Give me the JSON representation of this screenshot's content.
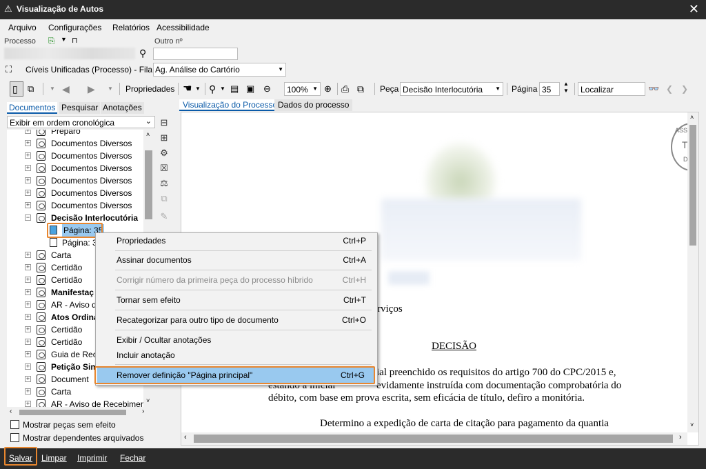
{
  "window": {
    "title": "Visualização de Autos",
    "close_glyph": "✕"
  },
  "menu": [
    "Arquivo",
    "Configurações",
    "Relatórios",
    "Acessibilidade"
  ],
  "process": {
    "label": "Processo",
    "other_label": "Outro nº",
    "other_value": ""
  },
  "queue": {
    "class_text": "Cíveis Unificadas (Processo) - Fila:",
    "fila_value": "Ag. Análise do Cartório"
  },
  "toolbar": {
    "properties_label": "Propriedades",
    "zoom_value": "100%",
    "peca_label": "Peça",
    "peca_value": "Decisão Interlocutória",
    "pagina_label": "Página",
    "pagina_value": "35",
    "localizar_placeholder": "Localizar"
  },
  "left_tabs": [
    "Documentos",
    "Pesquisar",
    "Anotações"
  ],
  "order_select": "Exibir em ordem cronológica",
  "tree": [
    {
      "label": "Preparo",
      "bold": false,
      "type": "doc"
    },
    {
      "label": "Documentos Diversos",
      "bold": false,
      "type": "doc"
    },
    {
      "label": "Documentos Diversos",
      "bold": false,
      "type": "doc"
    },
    {
      "label": "Documentos Diversos",
      "bold": false,
      "type": "doc"
    },
    {
      "label": "Documentos Diversos",
      "bold": false,
      "type": "doc"
    },
    {
      "label": "Documentos Diversos",
      "bold": false,
      "type": "doc"
    },
    {
      "label": "Documentos Diversos",
      "bold": false,
      "type": "doc"
    },
    {
      "label": "Decisão Interlocutória",
      "bold": true,
      "type": "doc-open"
    },
    {
      "label": "Página: 35",
      "bold": false,
      "type": "page-selected"
    },
    {
      "label": "Página: 3",
      "bold": false,
      "type": "page"
    },
    {
      "label": "Carta",
      "bold": false,
      "type": "doc"
    },
    {
      "label": "Certidão",
      "bold": false,
      "type": "doc"
    },
    {
      "label": "Certidão",
      "bold": false,
      "type": "doc"
    },
    {
      "label": "Manifestaç",
      "bold": true,
      "type": "doc"
    },
    {
      "label": "AR - Aviso de",
      "bold": false,
      "type": "doc"
    },
    {
      "label": "Atos Ordina",
      "bold": true,
      "type": "doc"
    },
    {
      "label": "Certidão",
      "bold": false,
      "type": "doc"
    },
    {
      "label": "Certidão",
      "bold": false,
      "type": "doc"
    },
    {
      "label": "Guia de Reco",
      "bold": false,
      "type": "doc"
    },
    {
      "label": "Petição Simp",
      "bold": true,
      "type": "doc"
    },
    {
      "label": "Document",
      "bold": false,
      "type": "doc"
    },
    {
      "label": "Carta",
      "bold": false,
      "type": "doc"
    },
    {
      "label": "AR - Aviso de Recebimento",
      "bold": false,
      "type": "doc"
    }
  ],
  "checkboxes": [
    "Mostrar peças sem efeito",
    "Mostrar dependentes arquivados"
  ],
  "viewer_tabs": [
    "Visualização do Processo",
    "Dados do processo"
  ],
  "document": {
    "fragment_servicos": "rviços",
    "heading": "DECISÃO",
    "line1_right": "ial preenchido os requisitos do artigo 700 do CPC/2015 e,",
    "line2_right": "evidamente  instruída  com  documentação  comprobatória  do",
    "line2_left": "estando  a  inicial",
    "line3": "débito, com base em prova escrita, sem eficácia de título, defiro a monitória.",
    "line4": "Determino a expedição de carta de citação para pagamento da quantia",
    "stamp_letters": [
      "ASS",
      "T",
      "D"
    ]
  },
  "context_menu": [
    {
      "label": "Propriedades",
      "shortcut": "Ctrl+P",
      "disabled": false
    },
    {
      "label": "Assinar documentos",
      "shortcut": "Ctrl+A",
      "disabled": false
    },
    {
      "label": "Corrigir número da primeira peça do processo híbrido",
      "shortcut": "Ctrl+H",
      "disabled": true
    },
    {
      "label": "Tornar sem efeito",
      "shortcut": "Ctrl+T",
      "disabled": false
    },
    {
      "label": "Recategorizar para outro tipo de documento",
      "shortcut": "Ctrl+O",
      "disabled": false
    },
    {
      "label": "Exibir / Ocultar anotações",
      "shortcut": "",
      "disabled": false
    },
    {
      "label": "Incluir anotação",
      "shortcut": "",
      "disabled": false
    },
    {
      "label": "Remover definição \"Página principal\"",
      "shortcut": "Ctrl+G",
      "disabled": false,
      "highlighted": true
    }
  ],
  "bottom_actions": [
    "Salvar",
    "Limpar",
    "Imprimir",
    "Fechar"
  ],
  "colors": {
    "highlight": "#e8862e",
    "selection": "#99c9ef",
    "bar": "#2b2b2b",
    "tab_active": "#0a5aa8"
  }
}
